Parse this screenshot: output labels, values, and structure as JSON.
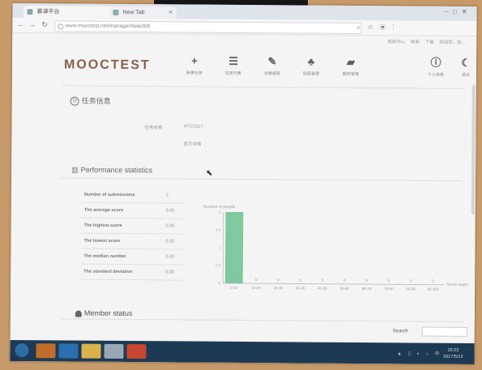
{
  "browser": {
    "tabs": [
      {
        "label": "慕课平台"
      },
      {
        "label": "New Tab"
      }
    ],
    "url": "www.mooctest.net/manager/task/8/8"
  },
  "header": {
    "user_links": [
      "帮助中心",
      "联系",
      "下载",
      "欢迎您，张..."
    ],
    "logo": "MOOCTEST",
    "nav": [
      {
        "icon": "plus-icon",
        "label": "新建任务"
      },
      {
        "icon": "list-icon",
        "label": "任务列表"
      },
      {
        "icon": "pen-icon",
        "label": "试卷编辑"
      },
      {
        "icon": "group-icon",
        "label": "班级管理"
      },
      {
        "icon": "folder-icon",
        "label": "题目管理"
      },
      {
        "icon": "info-icon",
        "label": "个人信息"
      },
      {
        "icon": "moon-icon",
        "label": "退出"
      }
    ]
  },
  "task_info": {
    "title": "任务信息",
    "name_label": "任务名称",
    "name_value": "MTC2017",
    "detail_link": "显示详情"
  },
  "performance": {
    "title": "Performance statistics",
    "stats": [
      {
        "label": "Number of submissions",
        "value": "2"
      },
      {
        "label": "The average score",
        "value": "0.00"
      },
      {
        "label": "The highest score",
        "value": "0.00"
      },
      {
        "label": "The lowest score",
        "value": "0.00"
      },
      {
        "label": "The median number",
        "value": "0.00"
      },
      {
        "label": "The standard deviation",
        "value": "0.00"
      }
    ]
  },
  "chart_data": {
    "type": "bar",
    "title": "",
    "ylabel": "Number of people",
    "xlabel": "Score segment",
    "categories": [
      "0-10",
      "10-20",
      "20-30",
      "30-40",
      "40-50",
      "50-60",
      "60-70",
      "70-80",
      "80-90",
      "90-100"
    ],
    "values": [
      2,
      0,
      0,
      0,
      0,
      0,
      0,
      0,
      0,
      0
    ],
    "ylim": [
      0,
      2
    ],
    "yticks": [
      "0",
      "0.5",
      "1",
      "1.5",
      "2"
    ],
    "bar_color": "#7fc8a0",
    "grid": false
  },
  "member_status": {
    "title": "Member status"
  },
  "search": {
    "label": "Search"
  },
  "taskbar": {
    "time": "10:23",
    "date": "2017/5/12"
  }
}
